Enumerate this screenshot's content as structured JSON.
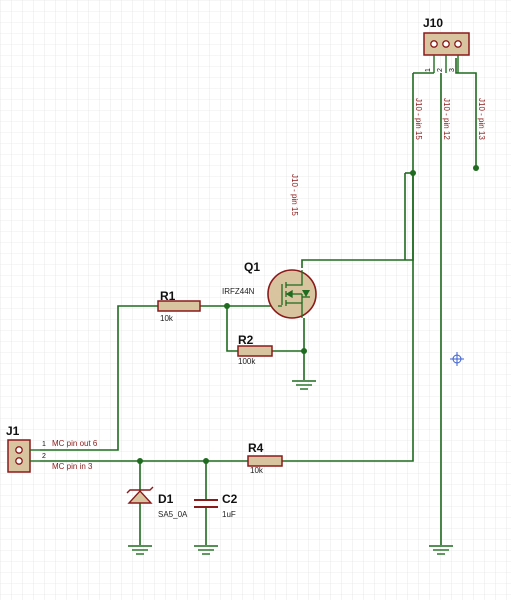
{
  "colors": {
    "background": "#ffffff",
    "grid": "#dcdcdc",
    "wire": "#1f6b1f",
    "component_body": "#d9c4a0",
    "component_outline": "#8b1a1a",
    "net_label": "#8b1a1a",
    "symbol_stroke": "#1f6b1f",
    "crosshair": "#3a5fd0"
  },
  "components": {
    "j10": {
      "ref": "J10",
      "pins": [
        "1",
        "2",
        "3"
      ]
    },
    "j1": {
      "ref": "J1",
      "pins": [
        "1",
        "2"
      ]
    },
    "q1": {
      "ref": "Q1",
      "value": "IRFZ44N"
    },
    "r1": {
      "ref": "R1",
      "value": "10k"
    },
    "r2": {
      "ref": "R2",
      "value": "100k"
    },
    "r4": {
      "ref": "R4",
      "value": "10k"
    },
    "d1": {
      "ref": "D1",
      "value": "SA5_0A"
    },
    "c2": {
      "ref": "C2",
      "value": "1uF"
    }
  },
  "net_labels": {
    "j10_pin15": "J10 - pin 15",
    "j10_pin12": "J10 - pin 12",
    "j10_pin13": "J10 - pin 13",
    "gate_net": "J10 - pin 15",
    "mc_pin_out_6": "MC pin out 6",
    "mc_pin_in_3": "MC pin in 3"
  }
}
